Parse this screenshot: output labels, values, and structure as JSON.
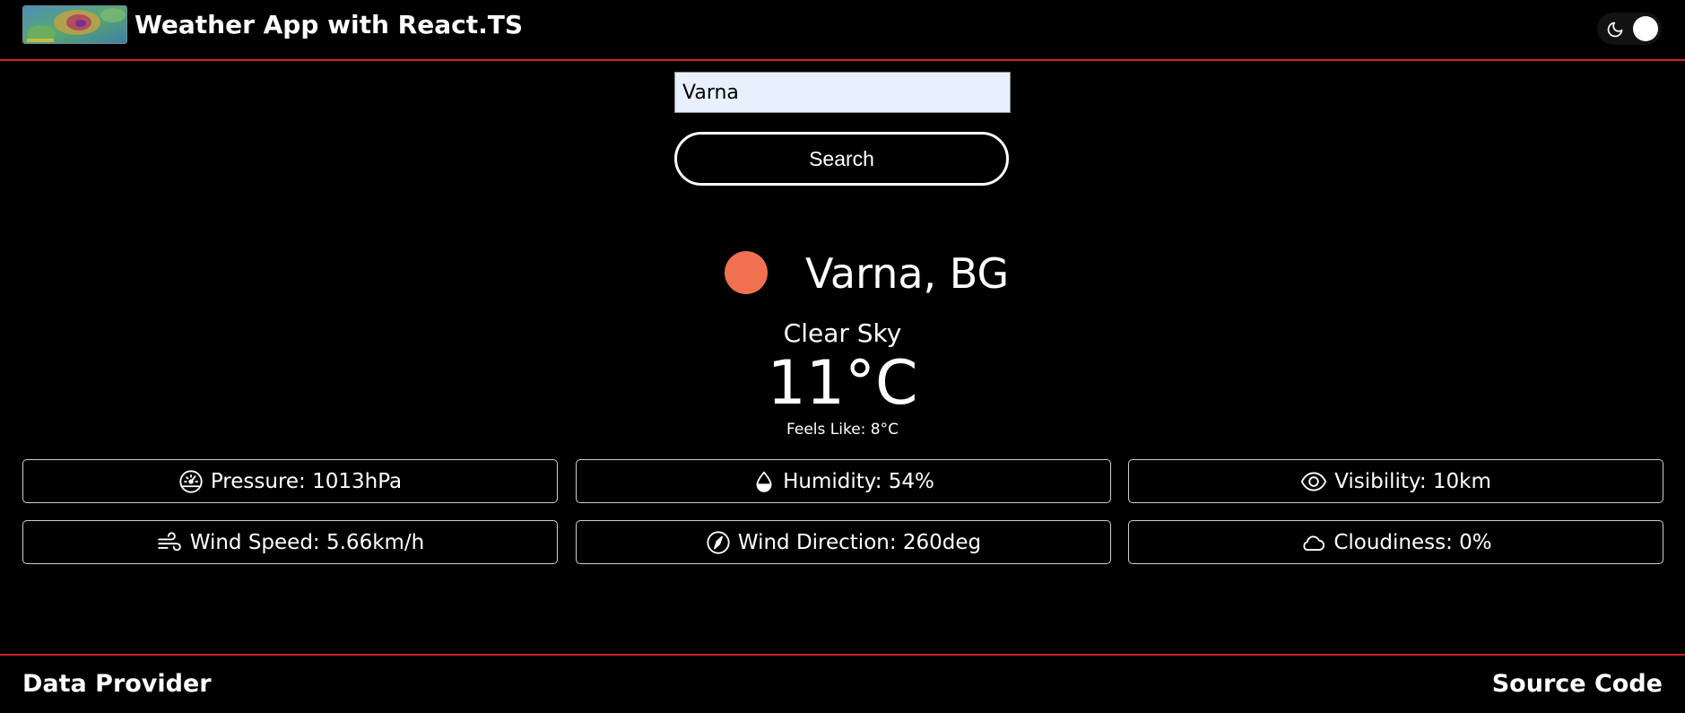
{
  "header": {
    "title": "Weather App with React.TS",
    "logo_icon": "weather-map-logo",
    "theme_toggle_icon": "moon-icon"
  },
  "search": {
    "value": "Varna",
    "button_label": "Search"
  },
  "weather": {
    "icon": "sun-icon",
    "icon_color": "#f07050",
    "location": "Varna, BG",
    "description": "Clear Sky",
    "temperature": "11°C",
    "feels_like": "Feels Like: 8°C"
  },
  "details": {
    "pressure": "Pressure: 1013hPa",
    "humidity": "Humidity: 54%",
    "visibility": "Visibility: 10km",
    "wind_speed": "Wind Speed: 5.66km/h",
    "wind_direction": "Wind Direction: 260deg",
    "cloudiness": "Cloudiness: 0%"
  },
  "footer": {
    "data_provider": "Data Provider",
    "source_code": "Source Code"
  },
  "colors": {
    "accent": "#d0202a",
    "background": "#000000",
    "text": "#ffffff",
    "input_background": "#e8f0fe"
  }
}
